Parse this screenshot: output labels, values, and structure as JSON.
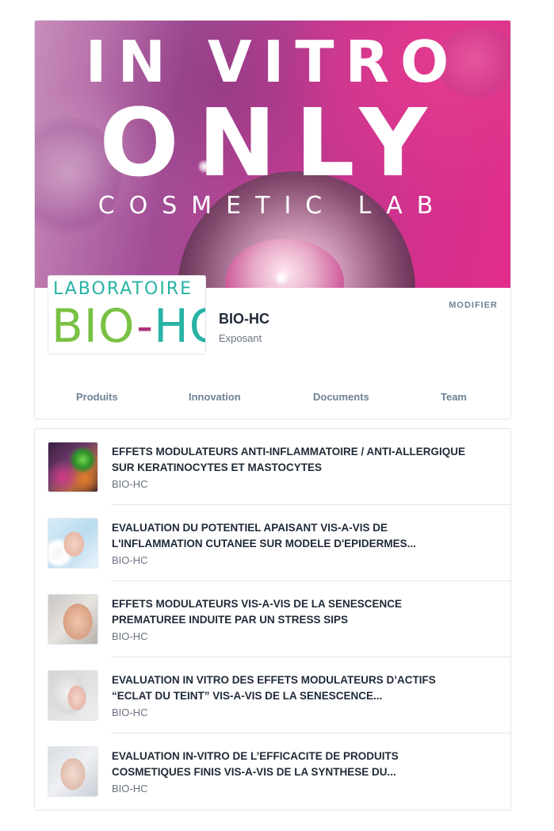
{
  "banner": {
    "line1": "IN VITRO",
    "line2": "ONLY",
    "line3": "COSMETIC LAB"
  },
  "logo": {
    "top": "LABORATOIRE",
    "bio": "BIO",
    "dash": "-",
    "hc": "HC"
  },
  "company": {
    "name": "BIO-HC",
    "role": "Exposant",
    "modify_label": "MODIFIER"
  },
  "tabs": [
    {
      "label": "Produits"
    },
    {
      "label": "Innovation"
    },
    {
      "label": "Documents"
    },
    {
      "label": "Team"
    }
  ],
  "items": [
    {
      "title": "EFFETS MODULATEURS ANTI-INFLAMMATOIRE / ANTI-ALLERGIQUE SUR KERATINOCYTES ET MASTOCYTES",
      "subtitle": "BIO-HC"
    },
    {
      "title": "EVALUATION DU POTENTIEL APAISANT VIS-A-VIS DE L'INFLAMMATION CUTANEE SUR MODELE D'EPIDERMES...",
      "subtitle": "BIO-HC"
    },
    {
      "title": "EFFETS MODULATEURS VIS-A-VIS DE LA SENESCENCE PREMATUREE INDUITE PAR UN STRESS SIPS",
      "subtitle": "BIO-HC"
    },
    {
      "title": "EVALUATION IN VITRO DES EFFETS MODULATEURS D’ACTIFS “ECLAT DU TEINT” VIS-A-VIS DE LA SENESCENCE...",
      "subtitle": "BIO-HC"
    },
    {
      "title": "EVALUATION IN-VITRO DE L’EFFICACITE DE PRODUITS COSMETIQUES FINIS VIS-A-VIS DE LA SYNTHESE DU...",
      "subtitle": "BIO-HC"
    }
  ]
}
